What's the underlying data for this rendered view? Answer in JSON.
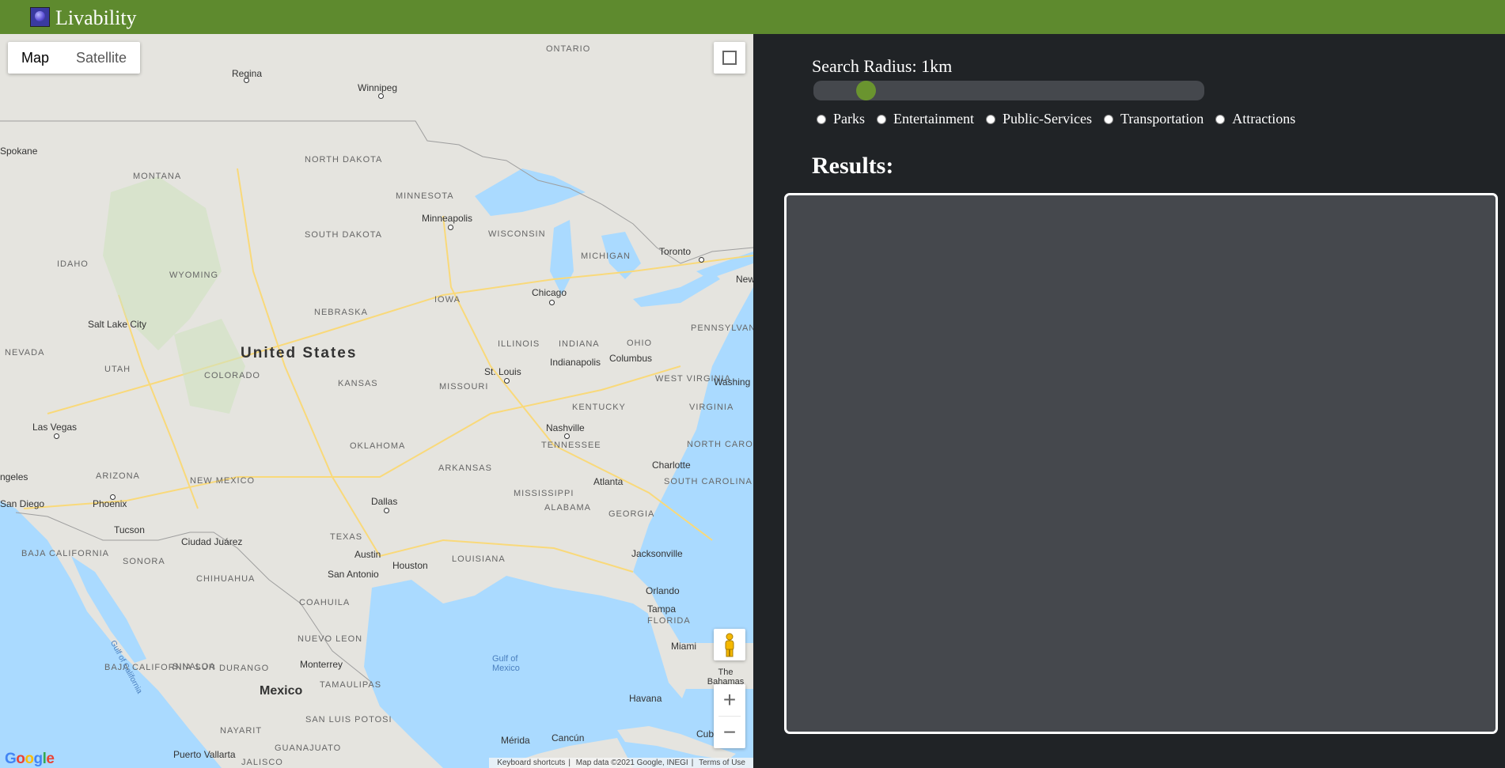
{
  "header": {
    "brand": "Livability",
    "logo_icon": "globe-logo-icon",
    "background": "#5e8a2e"
  },
  "map": {
    "type_buttons": [
      "Map",
      "Satellite"
    ],
    "active_type": "Map",
    "country_label": "United States",
    "mexico_label": "Mexico",
    "state_labels": [
      "ONTARIO",
      "NORTH DAKOTA",
      "MINNESOTA",
      "MONTANA",
      "SOUTH DAKOTA",
      "WISCONSIN",
      "MICHIGAN",
      "IDAHO",
      "WYOMING",
      "NEBRASKA",
      "IOWA",
      "NEVADA",
      "UTAH",
      "COLORADO",
      "KANSAS",
      "MISSOURI",
      "ILLINOIS",
      "INDIANA",
      "OHIO",
      "PENNSYLVANIA",
      "WEST VIRGINIA",
      "VIRGINIA",
      "KENTUCKY",
      "TENNESSEE",
      "NORTH CAROLINA",
      "SOUTH CAROLINA",
      "OKLAHOMA",
      "ARKANSAS",
      "ARIZONA",
      "NEW MEXICO",
      "MISSISSIPPI",
      "ALABAMA",
      "GEORGIA",
      "TEXAS",
      "LOUISIANA",
      "FLORIDA",
      "BAJA CALIFORNIA",
      "SONORA",
      "CHIHUAHUA",
      "COAHUILA",
      "NUEVO LEON",
      "SINALOA",
      "DURANGO",
      "TAMAULIPAS",
      "BAJA CALIFORNIA SUR",
      "SAN LUIS POTOSI",
      "NAYARIT",
      "GUANAJUATO",
      "JALISCO"
    ],
    "city_labels": [
      "Regina",
      "Winnipeg",
      "Spokane",
      "Minneapolis",
      "Toronto",
      "Salt Lake City",
      "Chicago",
      "St. Louis",
      "Indianapolis",
      "Columbus",
      "Washing",
      "Las Vegas",
      "Nashville",
      "Charlotte",
      "Atlanta",
      "Phoenix",
      "San Diego",
      "Tucson",
      "Ciudad Juárez",
      "Dallas",
      "Austin",
      "San Antonio",
      "Houston",
      "Jacksonville",
      "Orlando",
      "Tampa",
      "Miami",
      "Monterrey",
      "Havana",
      "Mérida",
      "Cancún",
      "Puerto Vallarta",
      "Cub",
      "ngeles",
      "New"
    ],
    "water_labels": [
      "Gulf of Mexico",
      "Gulf of California",
      "The Bahamas"
    ],
    "attribution": [
      "Keyboard shortcuts",
      "Map data ©2021 Google, INEGI",
      "Terms of Use"
    ],
    "google_logo": "Google",
    "zoom_in": "+",
    "zoom_out": "−"
  },
  "panel": {
    "radius_label": "Search Radius: 1km",
    "radius_slider": {
      "value_fraction": 0.04
    },
    "categories": [
      "Parks",
      "Entertainment",
      "Public-Services",
      "Transportation",
      "Attractions"
    ],
    "results_title": "Results:",
    "accent": "#6a942f"
  }
}
